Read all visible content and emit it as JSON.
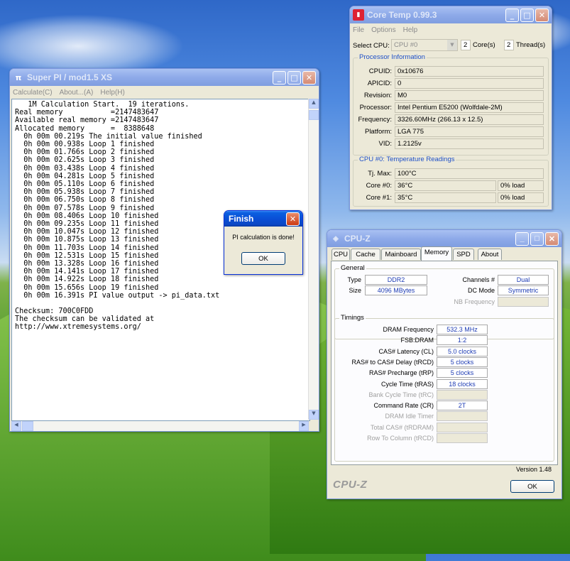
{
  "superpi": {
    "title": "Super PI / mod1.5 XS",
    "menu": [
      "Calculate(C)",
      "About...(A)",
      "Help(H)"
    ],
    "output_lines": [
      "   1M Calculation Start.  19 iterations.",
      "Real memory           =2147483647",
      "Available real memory =2147483647",
      "Allocated memory      =  8388648",
      "  0h 00m 00.219s The initial value finished",
      "  0h 00m 00.938s Loop 1 finished",
      "  0h 00m 01.766s Loop 2 finished",
      "  0h 00m 02.625s Loop 3 finished",
      "  0h 00m 03.438s Loop 4 finished",
      "  0h 00m 04.281s Loop 5 finished",
      "  0h 00m 05.110s Loop 6 finished",
      "  0h 00m 05.938s Loop 7 finished",
      "  0h 00m 06.750s Loop 8 finished",
      "  0h 00m 07.578s Loop 9 finished",
      "  0h 00m 08.406s Loop 10 finished",
      "  0h 00m 09.235s Loop 11 finished",
      "  0h 00m 10.047s Loop 12 finished",
      "  0h 00m 10.875s Loop 13 finished",
      "  0h 00m 11.703s Loop 14 finished",
      "  0h 00m 12.531s Loop 15 finished",
      "  0h 00m 13.328s Loop 16 finished",
      "  0h 00m 14.141s Loop 17 finished",
      "  0h 00m 14.922s Loop 18 finished",
      "  0h 00m 15.656s Loop 19 finished",
      "  0h 00m 16.391s PI value output -> pi_data.txt",
      "",
      "Checksum: 700C0FDD",
      "The checksum can be validated at",
      "http://www.xtremesystems.org/"
    ]
  },
  "finish_dialog": {
    "title": "Finish",
    "message": "PI calculation is done!",
    "ok_label": "OK"
  },
  "coretemp": {
    "title": "Core Temp 0.99.3",
    "menu": [
      "File",
      "Options",
      "Help"
    ],
    "select_cpu_label": "Select CPU:",
    "select_cpu_value": "CPU #0",
    "cores_count": "2",
    "cores_label": "Core(s)",
    "threads_count": "2",
    "threads_label": "Thread(s)",
    "processor_info_title": "Processor Information",
    "info": [
      {
        "label": "CPUID:",
        "value": "0x10676"
      },
      {
        "label": "APICID:",
        "value": "0"
      },
      {
        "label": "Revision:",
        "value": "M0"
      },
      {
        "label": "Processor:",
        "value": "Intel Pentium E5200 (Wolfdale-2M)"
      },
      {
        "label": "Frequency:",
        "value": "3326.60MHz (266.13 x 12.5)"
      },
      {
        "label": "Platform:",
        "value": "LGA 775"
      },
      {
        "label": "VID:",
        "value": "1.2125v"
      }
    ],
    "temp_title": "CPU #0: Temperature Readings",
    "tjmax_label": "Tj. Max:",
    "tjmax_value": "100°C",
    "cores": [
      {
        "label": "Core #0:",
        "temp": "36°C",
        "load": "0% load"
      },
      {
        "label": "Core #1:",
        "temp": "35°C",
        "load": "0% load"
      }
    ]
  },
  "cpuz": {
    "title": "CPU-Z",
    "tabs": [
      "CPU",
      "Cache",
      "Mainboard",
      "Memory",
      "SPD",
      "About"
    ],
    "active_tab": "Memory",
    "general_title": "General",
    "type_label": "Type",
    "type_value": "DDR2",
    "size_label": "Size",
    "size_value": "4096 MBytes",
    "channels_label": "Channels #",
    "channels_value": "Dual",
    "dcmode_label": "DC Mode",
    "dcmode_value": "Symmetric",
    "nbfreq_label": "NB Frequency",
    "timings_title": "Timings",
    "timings": [
      {
        "label": "DRAM Frequency",
        "value": "532.3 MHz"
      },
      {
        "label": "FSB:DRAM",
        "value": "1:2"
      },
      {
        "label": "CAS# Latency (CL)",
        "value": "5.0 clocks"
      },
      {
        "label": "RAS# to CAS# Delay (tRCD)",
        "value": "5 clocks"
      },
      {
        "label": "RAS# Precharge (tRP)",
        "value": "5 clocks"
      },
      {
        "label": "Cycle Time (tRAS)",
        "value": "18 clocks"
      },
      {
        "label": "Bank Cycle Time (tRC)",
        "value": ""
      },
      {
        "label": "Command Rate (CR)",
        "value": "2T"
      },
      {
        "label": "DRAM Idle Timer",
        "value": ""
      },
      {
        "label": "Total CAS# (tRDRAM)",
        "value": ""
      },
      {
        "label": "Row To Column (tRCD)",
        "value": ""
      }
    ],
    "version": "Version 1.48",
    "brand": "CPU-Z",
    "ok_label": "OK"
  }
}
